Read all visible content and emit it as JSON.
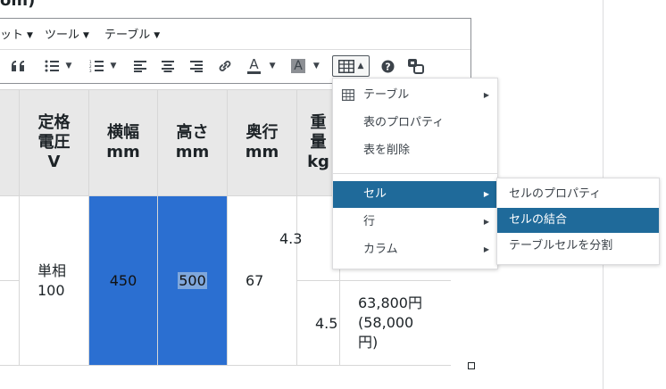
{
  "page": {
    "title_fragment": "om)"
  },
  "menubar": [
    {
      "label": "ット"
    },
    {
      "label": "ツール"
    },
    {
      "label": "テーブル"
    }
  ],
  "toolbar": {
    "blockquote_icon": "quote-icon",
    "bullet_list_icon": "bullet-list-icon",
    "numbered_list_icon": "numbered-list-icon",
    "align_left_icon": "align-left-icon",
    "align_center_icon": "align-center-icon",
    "align_right_icon": "align-right-icon",
    "link_icon": "link-icon",
    "text_color_letter": "A",
    "bg_color_letter": "A",
    "table_icon": "table-icon",
    "help_icon": "help-icon",
    "special_icon": "special-chars-icon"
  },
  "table": {
    "headers": [
      "",
      "定格\n電圧\nV",
      "横幅\nmm",
      "高さ\nmm",
      "奥行\nmm",
      "重\n量\nkg",
      ""
    ],
    "rows": [
      [
        "",
        "単相\n100",
        "450",
        "500",
        "67",
        "4.3",
        ""
      ],
      [
        "",
        "",
        "",
        "",
        "",
        "4.5",
        "63,800円\n(58,000\n円)"
      ]
    ]
  },
  "table_menu": {
    "items": [
      {
        "label": "テーブル",
        "has_submenu": true
      },
      {
        "label": "表のプロパティ",
        "has_submenu": false
      },
      {
        "label": "表を削除",
        "has_submenu": false
      },
      {
        "label": "セル",
        "has_submenu": true
      },
      {
        "label": "行",
        "has_submenu": true
      },
      {
        "label": "カラム",
        "has_submenu": true
      }
    ]
  },
  "cell_submenu": {
    "items": [
      {
        "label": "セルのプロパティ"
      },
      {
        "label": "セルの結合"
      },
      {
        "label": "テーブルセルを分割"
      }
    ]
  },
  "colors": {
    "selected_cell": "#2b6fd1",
    "menu_active": "#1f6a9a",
    "header_bg": "#e8e8e8"
  }
}
